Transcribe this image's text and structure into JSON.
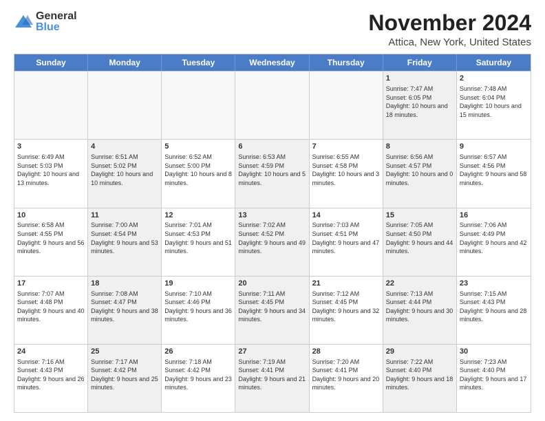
{
  "header": {
    "logo_general": "General",
    "logo_blue": "Blue",
    "title": "November 2024",
    "subtitle": "Attica, New York, United States"
  },
  "days": [
    "Sunday",
    "Monday",
    "Tuesday",
    "Wednesday",
    "Thursday",
    "Friday",
    "Saturday"
  ],
  "rows": [
    [
      {
        "num": "",
        "text": "",
        "empty": true
      },
      {
        "num": "",
        "text": "",
        "empty": true
      },
      {
        "num": "",
        "text": "",
        "empty": true
      },
      {
        "num": "",
        "text": "",
        "empty": true
      },
      {
        "num": "",
        "text": "",
        "empty": true
      },
      {
        "num": "1",
        "text": "Sunrise: 7:47 AM\nSunset: 6:05 PM\nDaylight: 10 hours and 18 minutes.",
        "shaded": true
      },
      {
        "num": "2",
        "text": "Sunrise: 7:48 AM\nSunset: 6:04 PM\nDaylight: 10 hours and 15 minutes.",
        "shaded": false
      }
    ],
    [
      {
        "num": "3",
        "text": "Sunrise: 6:49 AM\nSunset: 5:03 PM\nDaylight: 10 hours and 13 minutes.",
        "shaded": false
      },
      {
        "num": "4",
        "text": "Sunrise: 6:51 AM\nSunset: 5:02 PM\nDaylight: 10 hours and 10 minutes.",
        "shaded": true
      },
      {
        "num": "5",
        "text": "Sunrise: 6:52 AM\nSunset: 5:00 PM\nDaylight: 10 hours and 8 minutes.",
        "shaded": false
      },
      {
        "num": "6",
        "text": "Sunrise: 6:53 AM\nSunset: 4:59 PM\nDaylight: 10 hours and 5 minutes.",
        "shaded": true
      },
      {
        "num": "7",
        "text": "Sunrise: 6:55 AM\nSunset: 4:58 PM\nDaylight: 10 hours and 3 minutes.",
        "shaded": false
      },
      {
        "num": "8",
        "text": "Sunrise: 6:56 AM\nSunset: 4:57 PM\nDaylight: 10 hours and 0 minutes.",
        "shaded": true
      },
      {
        "num": "9",
        "text": "Sunrise: 6:57 AM\nSunset: 4:56 PM\nDaylight: 9 hours and 58 minutes.",
        "shaded": false
      }
    ],
    [
      {
        "num": "10",
        "text": "Sunrise: 6:58 AM\nSunset: 4:55 PM\nDaylight: 9 hours and 56 minutes.",
        "shaded": false
      },
      {
        "num": "11",
        "text": "Sunrise: 7:00 AM\nSunset: 4:54 PM\nDaylight: 9 hours and 53 minutes.",
        "shaded": true
      },
      {
        "num": "12",
        "text": "Sunrise: 7:01 AM\nSunset: 4:53 PM\nDaylight: 9 hours and 51 minutes.",
        "shaded": false
      },
      {
        "num": "13",
        "text": "Sunrise: 7:02 AM\nSunset: 4:52 PM\nDaylight: 9 hours and 49 minutes.",
        "shaded": true
      },
      {
        "num": "14",
        "text": "Sunrise: 7:03 AM\nSunset: 4:51 PM\nDaylight: 9 hours and 47 minutes.",
        "shaded": false
      },
      {
        "num": "15",
        "text": "Sunrise: 7:05 AM\nSunset: 4:50 PM\nDaylight: 9 hours and 44 minutes.",
        "shaded": true
      },
      {
        "num": "16",
        "text": "Sunrise: 7:06 AM\nSunset: 4:49 PM\nDaylight: 9 hours and 42 minutes.",
        "shaded": false
      }
    ],
    [
      {
        "num": "17",
        "text": "Sunrise: 7:07 AM\nSunset: 4:48 PM\nDaylight: 9 hours and 40 minutes.",
        "shaded": false
      },
      {
        "num": "18",
        "text": "Sunrise: 7:08 AM\nSunset: 4:47 PM\nDaylight: 9 hours and 38 minutes.",
        "shaded": true
      },
      {
        "num": "19",
        "text": "Sunrise: 7:10 AM\nSunset: 4:46 PM\nDaylight: 9 hours and 36 minutes.",
        "shaded": false
      },
      {
        "num": "20",
        "text": "Sunrise: 7:11 AM\nSunset: 4:45 PM\nDaylight: 9 hours and 34 minutes.",
        "shaded": true
      },
      {
        "num": "21",
        "text": "Sunrise: 7:12 AM\nSunset: 4:45 PM\nDaylight: 9 hours and 32 minutes.",
        "shaded": false
      },
      {
        "num": "22",
        "text": "Sunrise: 7:13 AM\nSunset: 4:44 PM\nDaylight: 9 hours and 30 minutes.",
        "shaded": true
      },
      {
        "num": "23",
        "text": "Sunrise: 7:15 AM\nSunset: 4:43 PM\nDaylight: 9 hours and 28 minutes.",
        "shaded": false
      }
    ],
    [
      {
        "num": "24",
        "text": "Sunrise: 7:16 AM\nSunset: 4:43 PM\nDaylight: 9 hours and 26 minutes.",
        "shaded": false
      },
      {
        "num": "25",
        "text": "Sunrise: 7:17 AM\nSunset: 4:42 PM\nDaylight: 9 hours and 25 minutes.",
        "shaded": true
      },
      {
        "num": "26",
        "text": "Sunrise: 7:18 AM\nSunset: 4:42 PM\nDaylight: 9 hours and 23 minutes.",
        "shaded": false
      },
      {
        "num": "27",
        "text": "Sunrise: 7:19 AM\nSunset: 4:41 PM\nDaylight: 9 hours and 21 minutes.",
        "shaded": true
      },
      {
        "num": "28",
        "text": "Sunrise: 7:20 AM\nSunset: 4:41 PM\nDaylight: 9 hours and 20 minutes.",
        "shaded": false
      },
      {
        "num": "29",
        "text": "Sunrise: 7:22 AM\nSunset: 4:40 PM\nDaylight: 9 hours and 18 minutes.",
        "shaded": true
      },
      {
        "num": "30",
        "text": "Sunrise: 7:23 AM\nSunset: 4:40 PM\nDaylight: 9 hours and 17 minutes.",
        "shaded": false
      }
    ]
  ]
}
